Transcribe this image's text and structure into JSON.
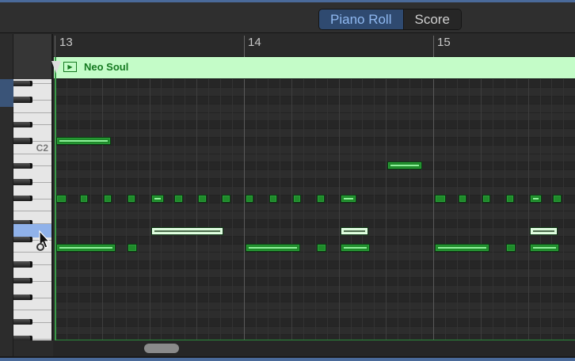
{
  "toolbar": {
    "tabs": [
      {
        "label": "Piano Roll",
        "active": true
      },
      {
        "label": "Score",
        "active": false
      }
    ]
  },
  "ruler": {
    "bars": [
      "13",
      "14",
      "15"
    ]
  },
  "region": {
    "name": "Neo Soul",
    "color": "#c4fcc8"
  },
  "keyboard": {
    "top_pitch": "G#2",
    "labels": [
      {
        "pitch": "C2",
        "text": "C2"
      }
    ],
    "highlighted": "D1"
  },
  "grid": {
    "sixteenths_per_bar": 16,
    "first_bar": 13
  },
  "notes": [
    {
      "pitch": "C#2",
      "start": 0,
      "length": 4.6,
      "selected": false
    },
    {
      "pitch": "A#1",
      "start": 28,
      "length": 2.9,
      "selected": false
    },
    {
      "pitch": "F#1",
      "start": 0,
      "length": 0.9,
      "selected": false
    },
    {
      "pitch": "F#1",
      "start": 2,
      "length": 0.7,
      "selected": false
    },
    {
      "pitch": "F#1",
      "start": 4,
      "length": 0.7,
      "selected": false
    },
    {
      "pitch": "F#1",
      "start": 6,
      "length": 0.7,
      "selected": false
    },
    {
      "pitch": "F#1",
      "start": 8,
      "length": 1.1,
      "selected": false
    },
    {
      "pitch": "F#1",
      "start": 10,
      "length": 0.7,
      "selected": false
    },
    {
      "pitch": "F#1",
      "start": 12,
      "length": 0.7,
      "selected": false
    },
    {
      "pitch": "F#1",
      "start": 14,
      "length": 0.7,
      "selected": false
    },
    {
      "pitch": "F#1",
      "start": 16,
      "length": 0.7,
      "selected": false
    },
    {
      "pitch": "F#1",
      "start": 18,
      "length": 0.7,
      "selected": false
    },
    {
      "pitch": "F#1",
      "start": 20,
      "length": 0.7,
      "selected": false
    },
    {
      "pitch": "F#1",
      "start": 22,
      "length": 0.7,
      "selected": false
    },
    {
      "pitch": "F#1",
      "start": 24,
      "length": 1.4,
      "selected": false
    },
    {
      "pitch": "F#1",
      "start": 32,
      "length": 0.9,
      "selected": false
    },
    {
      "pitch": "F#1",
      "start": 34,
      "length": 0.7,
      "selected": false
    },
    {
      "pitch": "F#1",
      "start": 36,
      "length": 0.7,
      "selected": false
    },
    {
      "pitch": "F#1",
      "start": 38,
      "length": 0.7,
      "selected": false
    },
    {
      "pitch": "F#1",
      "start": 40,
      "length": 1.0,
      "selected": false
    },
    {
      "pitch": "F#1",
      "start": 42,
      "length": 0.7,
      "selected": false
    },
    {
      "pitch": "D1",
      "start": 8,
      "length": 6.1,
      "selected": true
    },
    {
      "pitch": "D1",
      "start": 24,
      "length": 2.4,
      "selected": true
    },
    {
      "pitch": "D1",
      "start": 40,
      "length": 2.4,
      "selected": true
    },
    {
      "pitch": "C1",
      "start": 0,
      "length": 5.0,
      "selected": false
    },
    {
      "pitch": "C1",
      "start": 6,
      "length": 0.8,
      "selected": false
    },
    {
      "pitch": "C1",
      "start": 16,
      "length": 4.6,
      "selected": false
    },
    {
      "pitch": "C1",
      "start": 22,
      "length": 0.8,
      "selected": false
    },
    {
      "pitch": "C1",
      "start": 24,
      "length": 2.5,
      "selected": false
    },
    {
      "pitch": "C1",
      "start": 32,
      "length": 4.6,
      "selected": false
    },
    {
      "pitch": "C1",
      "start": 38,
      "length": 0.8,
      "selected": false
    },
    {
      "pitch": "C1",
      "start": 40,
      "length": 2.5,
      "selected": false
    }
  ]
}
